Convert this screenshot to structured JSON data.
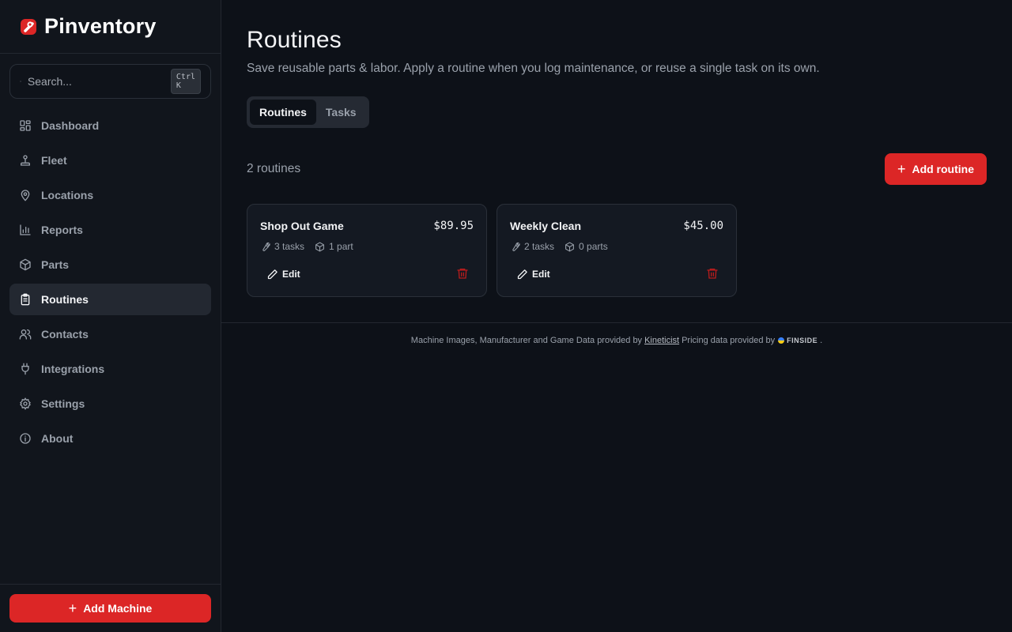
{
  "app": {
    "name": "Pinventory",
    "brand_color": "#dc2626"
  },
  "search": {
    "placeholder": "Search...",
    "shortcut": "Ctrl K"
  },
  "nav": {
    "items": [
      {
        "label": "Dashboard",
        "icon": "dashboard-icon",
        "active": false
      },
      {
        "label": "Fleet",
        "icon": "joystick-icon",
        "active": false
      },
      {
        "label": "Locations",
        "icon": "map-pin-icon",
        "active": false
      },
      {
        "label": "Reports",
        "icon": "bar-chart-icon",
        "active": false
      },
      {
        "label": "Parts",
        "icon": "package-icon",
        "active": false
      },
      {
        "label": "Routines",
        "icon": "clipboard-icon",
        "active": true
      },
      {
        "label": "Contacts",
        "icon": "users-icon",
        "active": false
      },
      {
        "label": "Integrations",
        "icon": "plug-icon",
        "active": false
      },
      {
        "label": "Settings",
        "icon": "gear-icon",
        "active": false
      },
      {
        "label": "About",
        "icon": "info-icon",
        "active": false
      }
    ]
  },
  "sidebar_footer": {
    "add_machine_label": "Add Machine"
  },
  "page": {
    "title": "Routines",
    "subtitle": "Save reusable parts & labor. Apply a routine when you log maintenance, or reuse a single task on its own.",
    "tabs": [
      {
        "label": "Routines",
        "active": true
      },
      {
        "label": "Tasks",
        "active": false
      }
    ],
    "count_text": "2 routines",
    "add_routine_label": "Add routine"
  },
  "routines": [
    {
      "name": "Shop Out Game",
      "price": "$89.95",
      "tasks": "3 tasks",
      "parts": "1 part",
      "edit_label": "Edit"
    },
    {
      "name": "Weekly Clean",
      "price": "$45.00",
      "tasks": "2 tasks",
      "parts": "0 parts",
      "edit_label": "Edit"
    }
  ],
  "footer": {
    "text_before": "Machine Images, Manufacturer and Game Data provided by",
    "link_label": "Kineticist",
    "text_middle": "Pricing data provided by",
    "pricing_brand": "FINSIDE",
    "text_after": "."
  }
}
